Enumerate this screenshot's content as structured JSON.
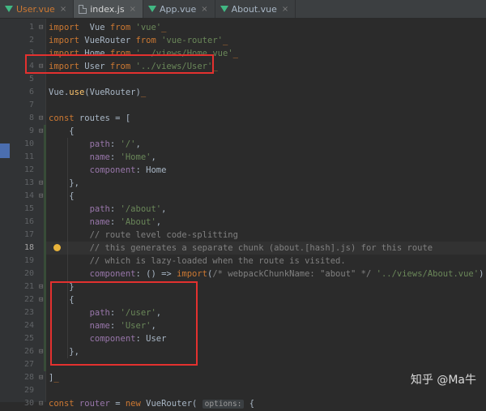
{
  "tabs": [
    {
      "name": "User.vue",
      "icon": "vue-icon",
      "active": false,
      "modified": true
    },
    {
      "name": "index.js",
      "icon": "js-file-icon",
      "active": true,
      "modified": false
    },
    {
      "name": "App.vue",
      "icon": "vue-icon",
      "active": false,
      "modified": false
    },
    {
      "name": "About.vue",
      "icon": "vue-icon",
      "active": false,
      "modified": false
    }
  ],
  "tab_close_glyph": "×",
  "editor": {
    "current_line": 18,
    "lines": [
      {
        "n": "1",
        "tokens": [
          [
            "kw",
            "import"
          ],
          [
            "",
            "  Vue "
          ],
          [
            "kw",
            "from"
          ],
          [
            "str",
            " 'vue'"
          ],
          [
            "kw",
            "_"
          ]
        ]
      },
      {
        "n": "2",
        "tokens": [
          [
            "kw",
            "import"
          ],
          [
            "",
            " VueRouter "
          ],
          [
            "kw",
            "from"
          ],
          [
            "str",
            " 'vue-router'"
          ],
          [
            "kw",
            "_"
          ]
        ]
      },
      {
        "n": "3",
        "tokens": [
          [
            "kw",
            "import"
          ],
          [
            "",
            " Home "
          ],
          [
            "kw",
            "from"
          ],
          [
            "str",
            " '../views/Home.vue'"
          ],
          [
            "kw",
            "_"
          ]
        ]
      },
      {
        "n": "4",
        "tokens": [
          [
            "kw",
            "import"
          ],
          [
            "",
            " User "
          ],
          [
            "kw",
            "from"
          ],
          [
            "str",
            " '../views/User'"
          ],
          [
            "kw",
            "_"
          ]
        ]
      },
      {
        "n": "5",
        "tokens": []
      },
      {
        "n": "6",
        "tokens": [
          [
            "",
            "Vue."
          ],
          [
            "fn",
            "use"
          ],
          [
            "",
            "(VueRouter)"
          ],
          [
            "kw",
            "_"
          ]
        ]
      },
      {
        "n": "7",
        "tokens": []
      },
      {
        "n": "8",
        "tokens": [
          [
            "kw",
            "const"
          ],
          [
            "",
            " routes = ["
          ]
        ]
      },
      {
        "n": "9",
        "tokens": [
          [
            "",
            "    {"
          ]
        ]
      },
      {
        "n": "10",
        "tokens": [
          [
            "",
            "        "
          ],
          [
            "prop",
            "path"
          ],
          [
            "",
            ": "
          ],
          [
            "str",
            "'/'"
          ],
          [
            "",
            ","
          ]
        ]
      },
      {
        "n": "11",
        "tokens": [
          [
            "",
            "        "
          ],
          [
            "prop",
            "name"
          ],
          [
            "",
            ": "
          ],
          [
            "str",
            "'Home'"
          ],
          [
            "",
            ","
          ]
        ]
      },
      {
        "n": "12",
        "tokens": [
          [
            "",
            "        "
          ],
          [
            "prop",
            "component"
          ],
          [
            "",
            ": Home"
          ]
        ]
      },
      {
        "n": "13",
        "tokens": [
          [
            "",
            "    },"
          ]
        ]
      },
      {
        "n": "14",
        "tokens": [
          [
            "",
            "    {"
          ]
        ]
      },
      {
        "n": "15",
        "tokens": [
          [
            "",
            "        "
          ],
          [
            "prop",
            "path"
          ],
          [
            "",
            ": "
          ],
          [
            "str",
            "'/about'"
          ],
          [
            "",
            ","
          ]
        ]
      },
      {
        "n": "16",
        "tokens": [
          [
            "",
            "        "
          ],
          [
            "prop",
            "name"
          ],
          [
            "",
            ": "
          ],
          [
            "str",
            "'About'"
          ],
          [
            "",
            ","
          ]
        ]
      },
      {
        "n": "17",
        "tokens": [
          [
            "",
            "        "
          ],
          [
            "cm",
            "// route level code-splitting"
          ]
        ]
      },
      {
        "n": "18",
        "tokens": [
          [
            "",
            "        "
          ],
          [
            "cm",
            "// this generates a separate chunk (about.[hash].js) for this route"
          ]
        ]
      },
      {
        "n": "19",
        "tokens": [
          [
            "",
            "        "
          ],
          [
            "cm",
            "// which is lazy-loaded when the route is visited."
          ]
        ]
      },
      {
        "n": "20",
        "tokens": [
          [
            "",
            "        "
          ],
          [
            "prop",
            "component"
          ],
          [
            "",
            ": () => "
          ],
          [
            "kw",
            "import"
          ],
          [
            "",
            "("
          ],
          [
            "cm",
            "/* webpackChunkName: \"about\" */"
          ],
          [
            "str",
            " '../views/About.vue'"
          ],
          [
            "",
            ")"
          ]
        ]
      },
      {
        "n": "21",
        "tokens": [
          [
            "",
            "    }"
          ]
        ]
      },
      {
        "n": "22",
        "tokens": [
          [
            "",
            "    {"
          ]
        ]
      },
      {
        "n": "23",
        "tokens": [
          [
            "",
            "        "
          ],
          [
            "prop",
            "path"
          ],
          [
            "",
            ": "
          ],
          [
            "str",
            "'/user'"
          ],
          [
            "",
            ","
          ]
        ]
      },
      {
        "n": "24",
        "tokens": [
          [
            "",
            "        "
          ],
          [
            "prop",
            "name"
          ],
          [
            "",
            ": "
          ],
          [
            "str",
            "'User'"
          ],
          [
            "",
            ","
          ]
        ]
      },
      {
        "n": "25",
        "tokens": [
          [
            "",
            "        "
          ],
          [
            "prop",
            "component"
          ],
          [
            "",
            ": User"
          ]
        ]
      },
      {
        "n": "26",
        "tokens": [
          [
            "",
            "    },"
          ]
        ]
      },
      {
        "n": "27",
        "tokens": []
      },
      {
        "n": "28",
        "tokens": [
          [
            "",
            "]"
          ],
          [
            "kw",
            "_"
          ]
        ]
      },
      {
        "n": "29",
        "tokens": []
      },
      {
        "n": "30",
        "tokens": [
          [
            "kw",
            "const"
          ],
          [
            "prop",
            " router"
          ],
          [
            "",
            " = "
          ],
          [
            "kw",
            "new"
          ],
          [
            "",
            " VueRouter( "
          ],
          [
            "hint",
            "options:"
          ],
          [
            "",
            " {"
          ]
        ]
      }
    ]
  },
  "watermark": "知乎 @Ma牛",
  "colors": {
    "keyword": "#cc7832",
    "string": "#6a8759",
    "property": "#9876aa",
    "comment": "#808080",
    "annotation_box": "#e3312f",
    "vue_green": "#41b883"
  }
}
